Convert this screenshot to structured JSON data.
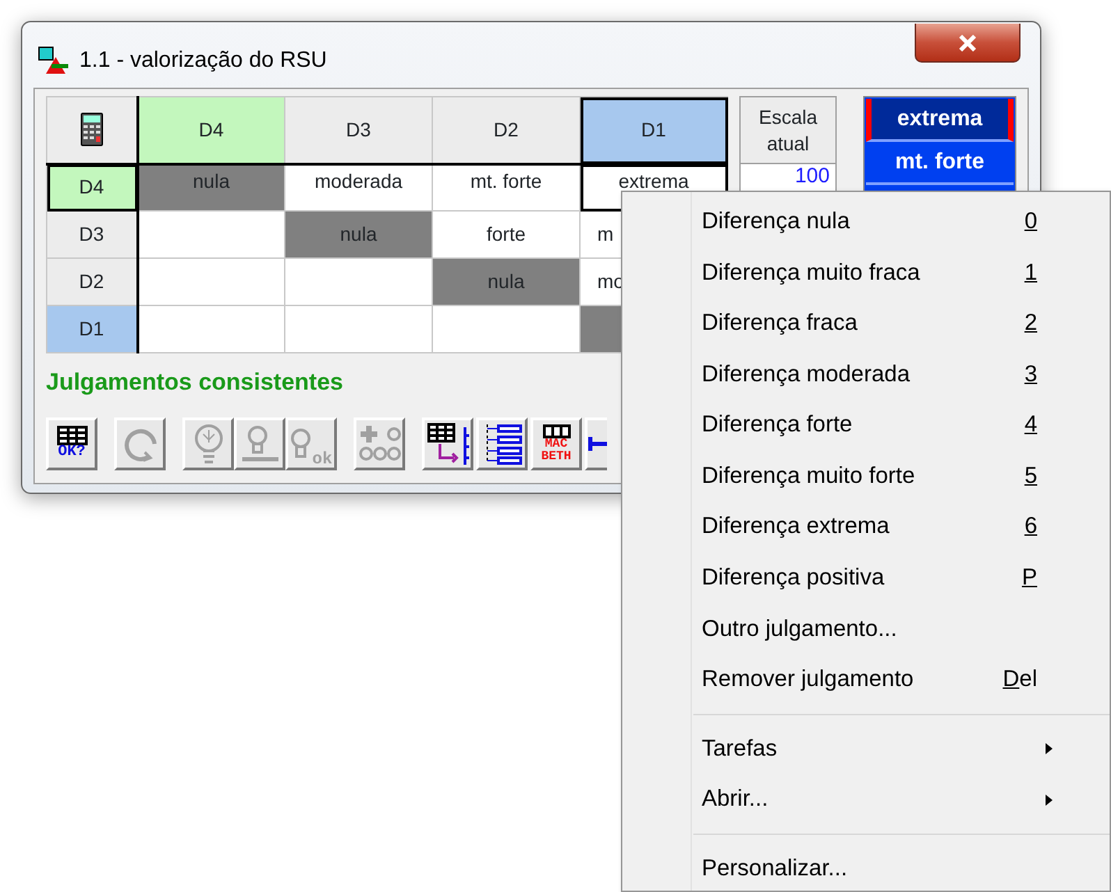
{
  "window": {
    "title": "1.1 - valorização do RSU"
  },
  "matrix": {
    "columns": [
      {
        "label": "D4",
        "color": "#c3f7bd",
        "selected": false
      },
      {
        "label": "D3",
        "selected": false
      },
      {
        "label": "D2",
        "selected": false
      },
      {
        "label": "D1",
        "color": "#a7c8ee",
        "selected": true
      }
    ],
    "rows": [
      {
        "label": "D4",
        "color": "#c3f7bd",
        "selected": true,
        "cells": [
          {
            "text": "nula",
            "kind": "diagonal",
            "selected": false
          },
          {
            "text": "moderada",
            "kind": "value",
            "selected": false
          },
          {
            "text": "mt. forte",
            "kind": "value",
            "selected": false
          },
          {
            "text": "extrema",
            "kind": "value",
            "selected": true
          }
        ]
      },
      {
        "label": "D3",
        "selected": false,
        "cells": [
          {
            "kind": "empty",
            "selected": false
          },
          {
            "text": "nula",
            "kind": "diagonal",
            "selected": false
          },
          {
            "text": "forte",
            "kind": "value",
            "selected": false
          },
          {
            "text": "m",
            "kind": "partial",
            "selected": false
          }
        ]
      },
      {
        "label": "D2",
        "selected": false,
        "cells": [
          {
            "kind": "empty",
            "selected": false
          },
          {
            "kind": "empty",
            "selected": false
          },
          {
            "text": "nula",
            "kind": "diagonal",
            "selected": false
          },
          {
            "text": "mo",
            "kind": "partial",
            "selected": false
          }
        ]
      },
      {
        "label": "D1",
        "color": "#a7c8ee",
        "selected": false,
        "cells": [
          {
            "kind": "empty",
            "selected": false
          },
          {
            "kind": "empty",
            "selected": false
          },
          {
            "kind": "empty",
            "selected": false
          },
          {
            "kind": "diagonal",
            "selected": false
          }
        ]
      }
    ]
  },
  "scale": {
    "header": "Escala atual",
    "value": "100"
  },
  "levels": [
    {
      "label": "extrema",
      "selected": true
    },
    {
      "label": "mt. forte",
      "selected": false
    }
  ],
  "status": "Julgamentos consistentes",
  "toolbar": [
    {
      "kind": "check",
      "label": "OK?",
      "disabled": false
    },
    {
      "kind": "refresh",
      "disabled": true
    },
    {
      "kind": "bulb",
      "disabled": true
    },
    {
      "kind": "bulb-bar",
      "disabled": true
    },
    {
      "kind": "bulb-ok",
      "label": "ok",
      "disabled": true
    },
    {
      "kind": "add-bulbs",
      "disabled": true
    },
    {
      "kind": "grid-arrow",
      "disabled": false
    },
    {
      "kind": "scale-list",
      "disabled": false
    },
    {
      "kind": "macbeth",
      "label_lines": [
        "MAC",
        "BETH"
      ],
      "disabled": false
    },
    {
      "kind": "range",
      "disabled": false
    }
  ],
  "context_menu": [
    {
      "kind": "item",
      "label": "Diferença nula",
      "shortcut": "0"
    },
    {
      "kind": "item",
      "label": "Diferença muito fraca",
      "shortcut": "1"
    },
    {
      "kind": "item",
      "label": "Diferença fraca",
      "shortcut": "2"
    },
    {
      "kind": "item",
      "label": "Diferença moderada",
      "shortcut": "3"
    },
    {
      "kind": "item",
      "label": "Diferença forte",
      "shortcut": "4"
    },
    {
      "kind": "item",
      "label": "Diferença muito forte",
      "shortcut": "5"
    },
    {
      "kind": "item",
      "label": "Diferença extrema",
      "shortcut": "6"
    },
    {
      "kind": "item",
      "label": "Diferença positiva",
      "shortcut": "P"
    },
    {
      "kind": "item",
      "label": "Outro julgamento..."
    },
    {
      "kind": "item",
      "label": "Remover julgamento",
      "shortcut": "Del"
    },
    {
      "kind": "separator"
    },
    {
      "kind": "submenu",
      "label": "Tarefas"
    },
    {
      "kind": "submenu",
      "label": "Abrir..."
    },
    {
      "kind": "separator"
    },
    {
      "kind": "item",
      "label": "Personalizar..."
    }
  ]
}
